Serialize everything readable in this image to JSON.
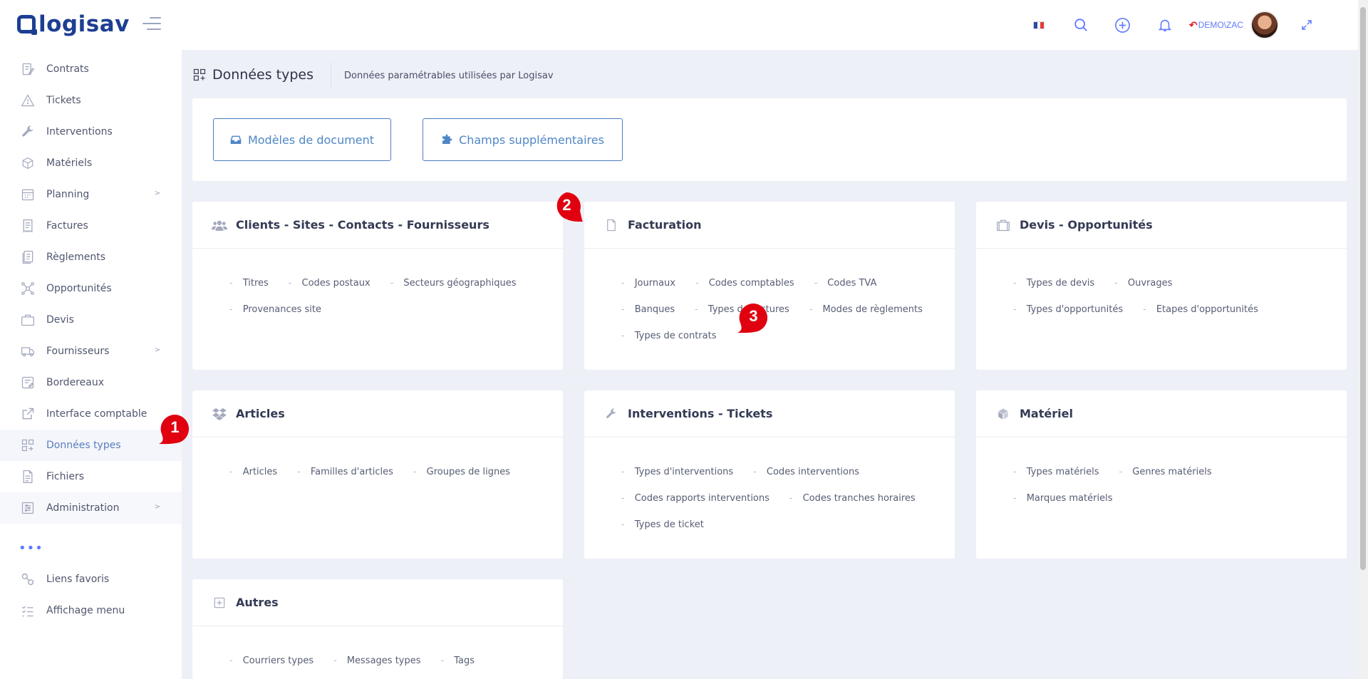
{
  "app": {
    "logo_text": "logisav",
    "user": "DEMO\\ZAC"
  },
  "sidebar": {
    "items": [
      {
        "label": "Contrats",
        "icon": "contract-icon"
      },
      {
        "label": "Tickets",
        "icon": "warning-icon"
      },
      {
        "label": "Interventions",
        "icon": "wrench-icon"
      },
      {
        "label": "Matériels",
        "icon": "cube-icon"
      },
      {
        "label": "Planning",
        "icon": "calendar-icon"
      },
      {
        "label": "Factures",
        "icon": "invoice-icon"
      },
      {
        "label": "Règlements",
        "icon": "payment-icon"
      },
      {
        "label": "Opportunités",
        "icon": "network-icon"
      },
      {
        "label": "Devis",
        "icon": "briefcase-icon"
      },
      {
        "label": "Fournisseurs",
        "icon": "truck-icon"
      },
      {
        "label": "Bordereaux",
        "icon": "slip-icon"
      },
      {
        "label": "Interface comptable",
        "icon": "external-link-icon"
      },
      {
        "label": "Données types",
        "icon": "grid-plus-icon"
      },
      {
        "label": "Fichiers",
        "icon": "file-icon"
      },
      {
        "label": "Administration",
        "icon": "sliders-icon"
      }
    ],
    "dots": "•••",
    "extra": [
      {
        "label": "Liens favoris",
        "icon": "link-icon"
      },
      {
        "label": "Affichage menu",
        "icon": "list-check-icon"
      }
    ]
  },
  "subheader": {
    "title": "Données types",
    "description": "Données paramétrables utilisées par Logisav"
  },
  "top_buttons": {
    "documents": "Modèles de document",
    "fields": "Champs supplémentaires"
  },
  "panels": {
    "clients": {
      "title": "Clients - Sites - Contacts - Fournisseurs",
      "links": [
        "Titres",
        "Codes postaux",
        "Secteurs géographiques",
        "Provenances site"
      ]
    },
    "facturation": {
      "title": "Facturation",
      "links": [
        "Journaux",
        "Codes comptables",
        "Codes TVA",
        "Banques",
        "Types de factures",
        "Modes de règlements",
        "Types de contrats"
      ]
    },
    "devis": {
      "title": "Devis - Opportunités",
      "links": [
        "Types de devis",
        "Ouvrages",
        "Types d'opportunités",
        "Etapes d'opportunités"
      ]
    },
    "articles": {
      "title": "Articles",
      "links": [
        "Articles",
        "Familles d'articles",
        "Groupes de lignes"
      ]
    },
    "interventions": {
      "title": "Interventions - Tickets",
      "links": [
        "Types d'interventions",
        "Codes interventions",
        "Codes rapports interventions",
        "Codes tranches horaires",
        "Types de ticket"
      ]
    },
    "materiel": {
      "title": "Matériel",
      "links": [
        "Types matériels",
        "Genres matériels",
        "Marques matériels"
      ]
    },
    "autres": {
      "title": "Autres",
      "links": [
        "Courriers types",
        "Messages types",
        "Tags"
      ]
    }
  },
  "markers": [
    "1",
    "2",
    "3"
  ],
  "colors": {
    "accent": "#4f86c6",
    "brand": "#1d3f93",
    "marker": "#e0000f",
    "background": "#eef0f8"
  }
}
